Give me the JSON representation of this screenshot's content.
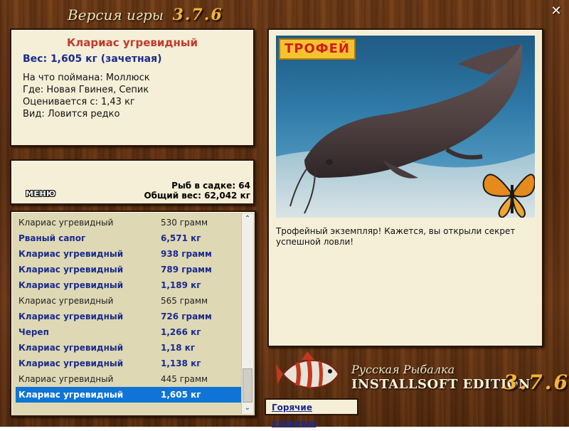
{
  "window": {
    "title": "Версия игры",
    "version": "3.7.6",
    "close_glyph": "✕"
  },
  "info": {
    "fish_name": "Клариас угревидный",
    "weight": "Вес: 1,605 кг (зачетная)",
    "details": [
      "На что поймана: Моллюск",
      "Где: Новая Гвинея, Сепик",
      "Оценивается с: 1,43 кг",
      "Вид: Ловится редко"
    ]
  },
  "stats": {
    "menu_label": "МЕНЮ",
    "fish_count": "Рыб в садке: 64",
    "total_weight": "Общий вес: 62,042 кг"
  },
  "catch_list": [
    {
      "name": "Клариас угревидный",
      "weight": "530 грамм",
      "style": "plain"
    },
    {
      "name": "Рваный сапог",
      "weight": "6,571 кг",
      "style": "bold"
    },
    {
      "name": "Клариас угревидный",
      "weight": "938 грамм",
      "style": "bold"
    },
    {
      "name": "Клариас угревидный",
      "weight": "789 грамм",
      "style": "bold"
    },
    {
      "name": "Клариас угревидный",
      "weight": "1,189 кг",
      "style": "bold"
    },
    {
      "name": "Клариас угревидный",
      "weight": "565 грамм",
      "style": "plain"
    },
    {
      "name": "Клариас угревидный",
      "weight": "726 грамм",
      "style": "bold"
    },
    {
      "name": "Череп",
      "weight": "1,266 кг",
      "style": "bold"
    },
    {
      "name": "Клариас угревидный",
      "weight": "1,18 кг",
      "style": "bold"
    },
    {
      "name": "Клариас угревидный",
      "weight": "1,138 кг",
      "style": "bold"
    },
    {
      "name": "Клариас угревидный",
      "weight": "445 грамм",
      "style": "plain"
    },
    {
      "name": "Клариас угревидный",
      "weight": "1,605 кг",
      "style": "selected"
    }
  ],
  "trophy": {
    "tag": "ТРОФЕЙ",
    "text": "Трофейный экземпляр! Кажется, вы открыли секрет успешной ловли!"
  },
  "brand": {
    "title": "Русская Рыбалка",
    "edition": "INSTALLSOFT EDITION",
    "version": "3.7.6"
  },
  "hotkeys_label": "Горячие клавиши",
  "scroll": {
    "up_glyph": "⌃",
    "down_glyph": "⌄"
  }
}
